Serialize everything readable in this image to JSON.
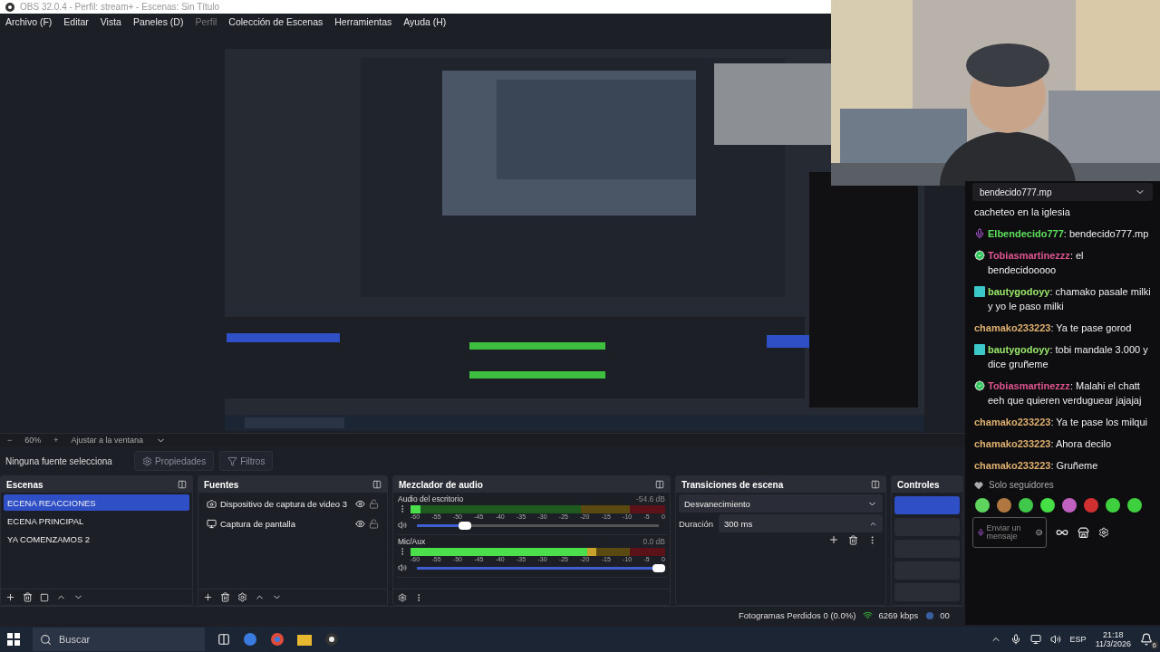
{
  "window": {
    "title": "OBS 32.0.4 - Perfil: stream+ - Escenas: Sin Título"
  },
  "menu": [
    {
      "label": "Archivo (F)",
      "disabled": false
    },
    {
      "label": "Editar",
      "disabled": false
    },
    {
      "label": "Vista",
      "disabled": false
    },
    {
      "label": "Paneles (D)",
      "disabled": false
    },
    {
      "label": "Perfil",
      "disabled": true
    },
    {
      "label": "Colección de Escenas",
      "disabled": false
    },
    {
      "label": "Herramientas",
      "disabled": false
    },
    {
      "label": "Ayuda (H)",
      "disabled": false
    }
  ],
  "zoom_bar": {
    "minus": "−",
    "zoom": "60%",
    "plus": "+",
    "fit": "Ajustar a la ventana"
  },
  "source_toolbar": {
    "status": "Ninguna fuente selecciona",
    "buttons": [
      {
        "label": "Propiedades",
        "disabled": true
      },
      {
        "label": "Filtros",
        "disabled": true
      }
    ]
  },
  "scenes": {
    "title": "Escenas",
    "items": [
      {
        "label": "ECENA REACCIONES",
        "selected": true
      },
      {
        "label": "ECENA PRINCIPAL",
        "selected": false
      },
      {
        "label": "YA COMENZAMOS 2",
        "selected": false
      }
    ]
  },
  "sources": {
    "title": "Fuentes",
    "items": [
      {
        "label": "Dispositivo de captura de video 3",
        "kind": "camera",
        "visible": true,
        "locked": false
      },
      {
        "label": "Captura de pantalla",
        "kind": "display",
        "visible": true,
        "locked": false
      }
    ]
  },
  "mixer": {
    "title": "Mezclador de audio",
    "channels": [
      {
        "name": "Audio del escritorio",
        "reading": "-54.6 dB",
        "level": 0.04,
        "volume": {
          "level": 0.2
        },
        "scale": [
          "-60",
          "-55",
          "-50",
          "-45",
          "-40",
          "-35",
          "-30",
          "-25",
          "-20",
          "-15",
          "-10",
          "-5",
          "0"
        ]
      },
      {
        "name": "Mic/Aux",
        "reading": "0.0 dB",
        "level": 0.73,
        "volume": {
          "level": 1
        },
        "scale": [
          "-60",
          "-55",
          "-50",
          "-45",
          "-40",
          "-35",
          "-30",
          "-25",
          "-20",
          "-15",
          "-10",
          "-5",
          "0"
        ]
      }
    ]
  },
  "transitions": {
    "title": "Transiciones de escena",
    "type": "Desvanecimiento",
    "duration_label": "Duración",
    "duration": "300 ms"
  },
  "controls": {
    "title": "Controles",
    "buttons": [
      {
        "active": true
      },
      {
        "active": false
      },
      {
        "active": false
      },
      {
        "active": false
      },
      {
        "active": false
      }
    ]
  },
  "status_bar": {
    "dropped": "Fotogramas Perdidos 0 (0.0%)",
    "bitrate": "6269 kbps",
    "time": "00"
  },
  "chat": {
    "pinned": "bendecido777.mp",
    "messages": [
      {
        "text": "cacheteo en la iglesia"
      },
      {
        "user": "Elbendecido777",
        "kind": "mic",
        "color": "#5ee05e",
        "text": ": bendecido777.mp"
      },
      {
        "user": "Tobiasmartinezzz",
        "kind": "verified",
        "color": "#e05590",
        "text": ": el bendecidooooo"
      },
      {
        "user": "bautygodoyy",
        "kind": "tile",
        "color": "#9ae86b",
        "text": ": chamako pasale milki y yo le paso milki"
      },
      {
        "user": "chamako233223",
        "color": "#e0b070",
        "text": ": Ya te pase gorod"
      },
      {
        "user": "bautygodoyy",
        "kind": "tile",
        "color": "#9ae86b",
        "text": ": tobi mandale 3.000 y dice gruñeme"
      },
      {
        "user": "Tobiasmartinezzz",
        "kind": "verified",
        "color": "#e05590",
        "text": ": Malahi el chatt eeh que quieren verduguear jajajaj"
      },
      {
        "user": "chamako233223",
        "color": "#e0b070",
        "text": ": Ya te pase los milqui"
      },
      {
        "user": "chamako233223",
        "color": "#e0b070",
        "text": ": Ahora decilo"
      },
      {
        "user": "chamako233223",
        "color": "#e0b070",
        "text": ": Gruñeme"
      }
    ],
    "mode": "Solo seguidores",
    "input": {
      "placeholder": "Enviar un mensaje"
    }
  },
  "taskbar": {
    "search": {
      "placeholder": "Buscar"
    },
    "language": "ESP",
    "time": "21:18",
    "date": "11/3/2026",
    "notifications": "6"
  }
}
